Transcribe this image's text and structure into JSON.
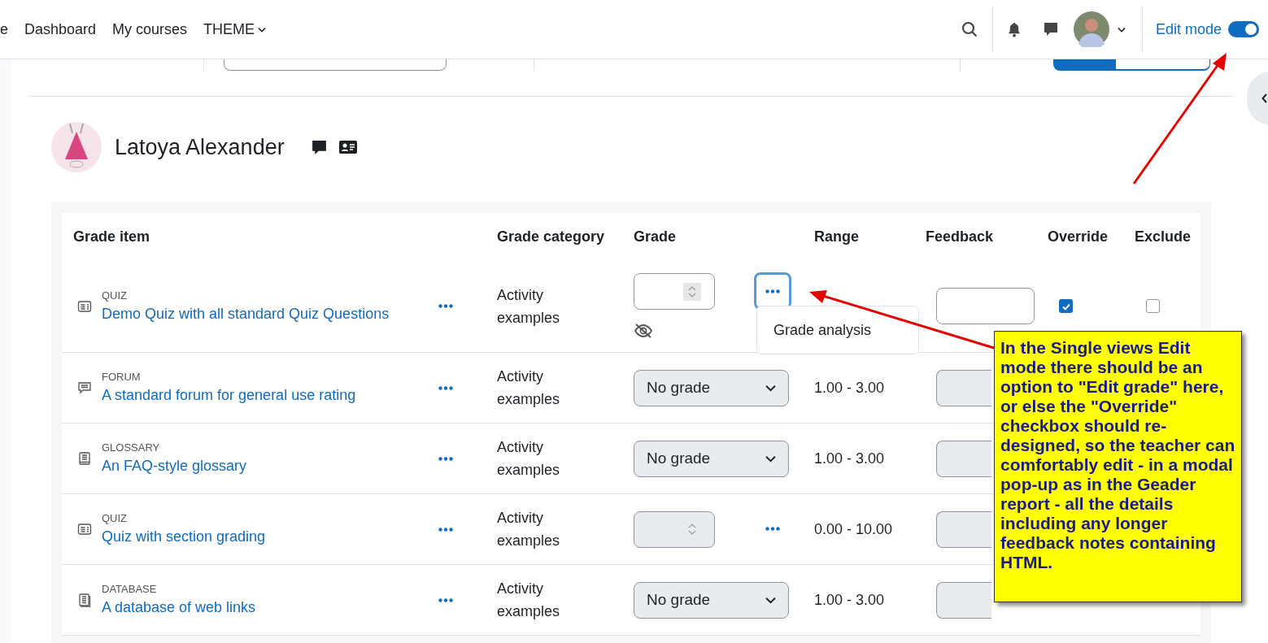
{
  "nav": {
    "items": [
      {
        "label": "e",
        "dropdown": false
      },
      {
        "label": "Dashboard",
        "dropdown": false
      },
      {
        "label": "My courses",
        "dropdown": false
      },
      {
        "label": "THEME",
        "dropdown": true
      }
    ],
    "edit_mode": {
      "label": "Edit mode",
      "on": true
    }
  },
  "view_tabs": [
    {
      "selected": true
    },
    {
      "selected": false
    }
  ],
  "user": {
    "name": "Latoya Alexander"
  },
  "table": {
    "columns": [
      "Grade item",
      "Grade category",
      "Grade",
      "Range",
      "Feedback",
      "Override",
      "Exclude"
    ],
    "rows": [
      {
        "kind": "quiz",
        "type": "QUIZ",
        "name": "Demo Quiz with all standard Quiz Questions",
        "category": "Activity examples",
        "grade": {
          "kind": "number",
          "disabled": false
        },
        "hidden": true,
        "grade_menu": true,
        "menu_focused": true,
        "feedback_disabled": false,
        "override": {
          "checked": true
        },
        "exclude": {
          "checked": false
        }
      },
      {
        "kind": "forum",
        "type": "FORUM",
        "name": "A standard forum for general use rating",
        "category": "Activity examples",
        "grade": {
          "kind": "select",
          "value": "No grade"
        },
        "hidden": false,
        "grade_menu": false,
        "range": "1.00 - 3.00",
        "feedback_disabled": true
      },
      {
        "kind": "glossary",
        "type": "GLOSSARY",
        "name": "An FAQ-style glossary",
        "category": "Activity examples",
        "grade": {
          "kind": "select",
          "value": "No grade"
        },
        "hidden": false,
        "grade_menu": false,
        "range": "1.00 - 3.00",
        "feedback_disabled": true
      },
      {
        "kind": "quiz",
        "type": "QUIZ",
        "name": "Quiz with section grading",
        "category": "Activity examples",
        "grade": {
          "kind": "number",
          "disabled": true
        },
        "hidden": false,
        "grade_menu": true,
        "menu_focused": false,
        "range": "0.00 - 10.00",
        "feedback_disabled": true
      },
      {
        "kind": "database",
        "type": "DATABASE",
        "name": "A database of web links",
        "category": "Activity examples",
        "grade": {
          "kind": "select",
          "value": "No grade"
        },
        "hidden": false,
        "grade_menu": false,
        "range": "1.00 - 3.00",
        "feedback_disabled": true
      }
    ]
  },
  "popover": {
    "items": [
      "Grade analysis"
    ]
  },
  "note": {
    "text": "In the Single views Edit mode there should be an option to \"Edit grade\" here, or else the \"Override\" checkbox should re-designed, so the teacher can comfortably edit - in a modal pop-up as in the Geader report - all the details including any longer feedback notes containing HTML."
  }
}
